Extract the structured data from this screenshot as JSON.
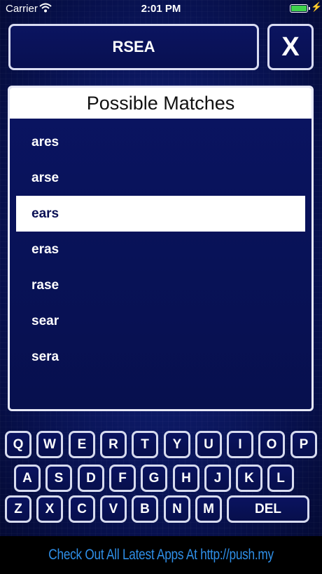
{
  "status_bar": {
    "carrier": "Carrier",
    "time": "2:01 PM",
    "battery_level": 1.0,
    "battery_color": "#3fd24c"
  },
  "input": {
    "letters": "RSEA",
    "clear_label": "X"
  },
  "matches": {
    "header": "Possible Matches",
    "items": [
      "ares",
      "arse",
      "ears",
      "eras",
      "rase",
      "sear",
      "sera"
    ],
    "selected_index": 2
  },
  "keyboard": {
    "row1": [
      "Q",
      "W",
      "E",
      "R",
      "T",
      "Y",
      "U",
      "I",
      "O",
      "P"
    ],
    "row2": [
      "A",
      "S",
      "D",
      "F",
      "G",
      "H",
      "J",
      "K",
      "L"
    ],
    "row3": [
      "Z",
      "X",
      "C",
      "V",
      "B",
      "N",
      "M"
    ],
    "del_label": "DEL"
  },
  "banner": {
    "text": "Check Out All Latest Apps At http://push.my"
  },
  "colors": {
    "background": "#0d1a66",
    "border": "#d9dcf2",
    "banner_text": "#2f8fe8"
  }
}
